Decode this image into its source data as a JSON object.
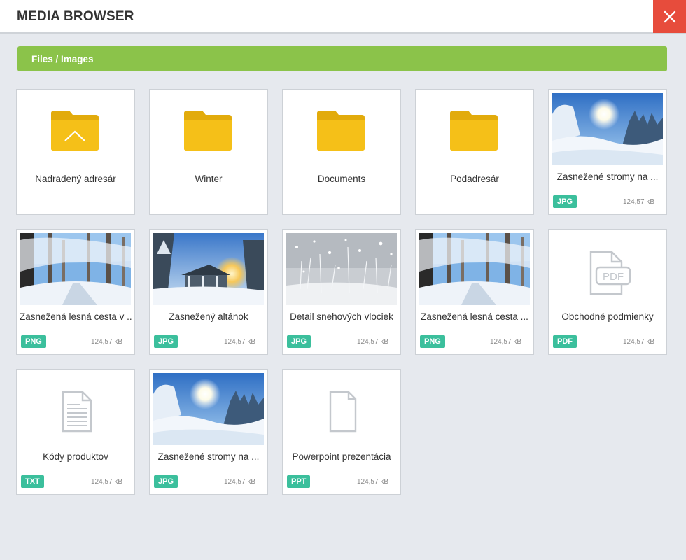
{
  "header": {
    "title": "MEDIA BROWSER",
    "close_icon": "close-icon"
  },
  "breadcrumb": {
    "path": "Files / Images"
  },
  "colors": {
    "accent_green": "#8bc34a",
    "close_red": "#e74c3c",
    "badge_teal": "#3bbf9c",
    "folder_yellow": "#f5c018",
    "icon_gray": "#c4c8cd"
  },
  "folders": [
    {
      "label": "Nadradený adresár",
      "icon": "folder-up-icon"
    },
    {
      "label": "Winter",
      "icon": "folder-icon"
    },
    {
      "label": "Documents",
      "icon": "folder-icon"
    },
    {
      "label": "Podadresár",
      "icon": "folder-icon"
    }
  ],
  "files": [
    {
      "label": "Zasnežené stromy na ...",
      "type": "JPG",
      "size": "124,57 kB",
      "preview": "snow-trees-sun-image"
    },
    {
      "label": "Zasnežená lesná cesta v ...",
      "type": "PNG",
      "size": "124,57 kB",
      "preview": "snowy-forest-path-image"
    },
    {
      "label": "Zasnežený altánok",
      "type": "JPG",
      "size": "124,57 kB",
      "preview": "snowy-gazebo-image"
    },
    {
      "label": "Detail snehových vlociek",
      "type": "JPG",
      "size": "124,57 kB",
      "preview": "snowflakes-detail-image"
    },
    {
      "label": "Zasnežená lesná cesta ...",
      "type": "PNG",
      "size": "124,57 kB",
      "preview": "snowy-forest-path-image"
    },
    {
      "label": "Obchodné podmienky",
      "type": "PDF",
      "size": "124,57 kB",
      "preview": "pdf-icon"
    },
    {
      "label": "Kódy produktov",
      "type": "TXT",
      "size": "124,57 kB",
      "preview": "text-file-icon"
    },
    {
      "label": "Zasnežené stromy na ...",
      "type": "JPG",
      "size": "124,57 kB",
      "preview": "snow-trees-sun-image"
    },
    {
      "label": "Powerpoint prezentácia",
      "type": "PPT",
      "size": "124,57 kB",
      "preview": "blank-file-icon"
    }
  ]
}
